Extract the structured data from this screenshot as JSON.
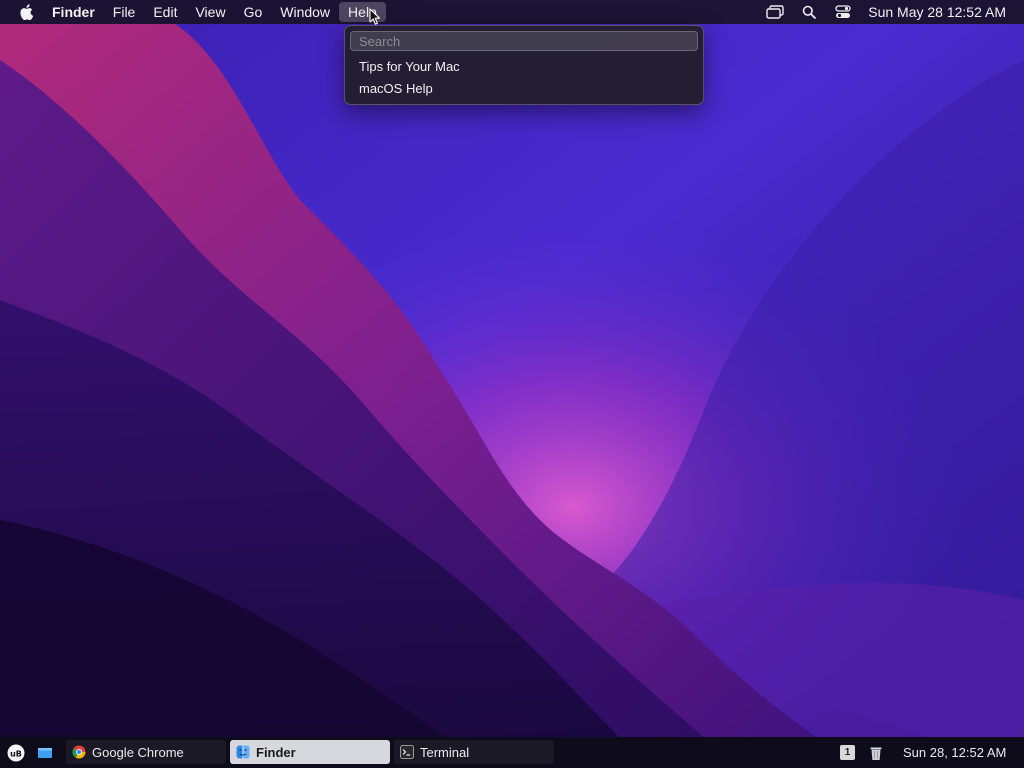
{
  "menubar": {
    "app_name": "Finder",
    "menus": [
      "File",
      "Edit",
      "View",
      "Go",
      "Window",
      "Help"
    ],
    "active_menu": "Help",
    "clock": "Sun May 28  12:52 AM",
    "status_icons": [
      "screen-mirroring-icon",
      "spotlight-search-icon",
      "control-center-icon"
    ]
  },
  "help_menu": {
    "search_placeholder": "Search",
    "items": [
      "Tips for Your Mac",
      "macOS Help"
    ]
  },
  "taskbar": {
    "tasks": [
      {
        "label": "Google Chrome",
        "icon": "chrome-icon",
        "active": false
      },
      {
        "label": "Finder",
        "icon": "finder-icon",
        "active": true
      },
      {
        "label": "Terminal",
        "icon": "terminal-icon",
        "active": false
      }
    ],
    "workspace_badge": "1",
    "clock": "Sun 28, 12:52 AM"
  },
  "colors": {
    "wallpaper_deep": "#1a0f4a",
    "wallpaper_violet": "#5b2bd6",
    "wallpaper_magenta": "#c62fbf",
    "accent": "#7b3fe4"
  }
}
